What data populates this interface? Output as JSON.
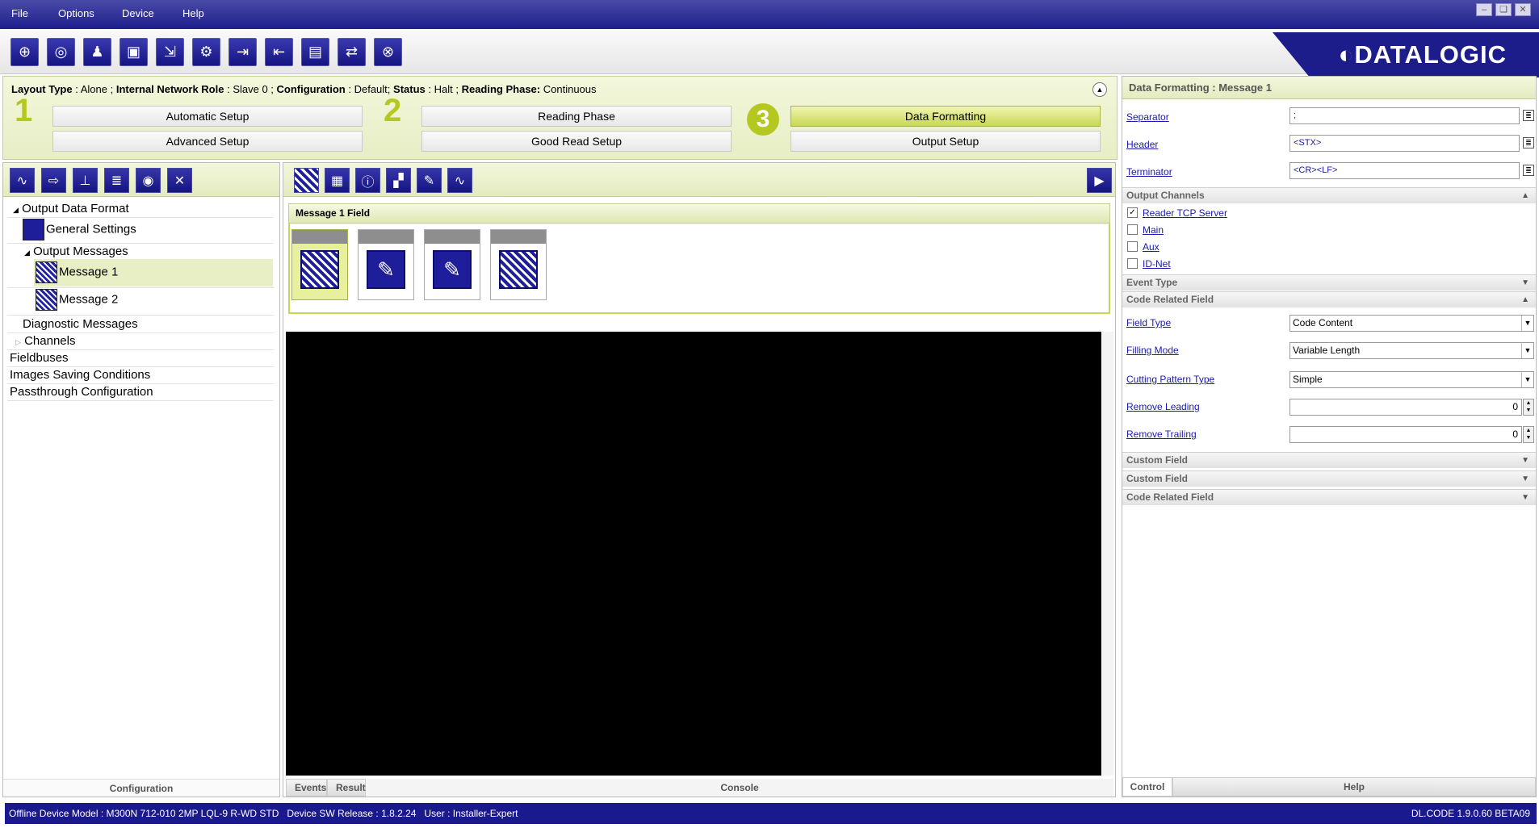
{
  "menu": {
    "file": "File",
    "options": "Options",
    "device": "Device",
    "help": "Help"
  },
  "window_controls": {
    "minimize": "–",
    "restore": "❏",
    "close": "✕"
  },
  "logo": "◐DATALOGIC",
  "toolbar_icons": [
    "crosshair-icon",
    "camera-search-icon",
    "user-icon",
    "layout-icon",
    "camera-arrow-icon",
    "camera-config-icon",
    "export-icon",
    "import-icon",
    "monitor-icon",
    "network-icon",
    "target-icon"
  ],
  "status_info": {
    "layout_type_label": "Layout Type",
    "layout_type_value": "Alone",
    "network_role_label": "Internal Network Role",
    "network_role_value": "Slave 0",
    "configuration_label": "Configuration",
    "configuration_value": "Default",
    "status_label": "Status",
    "status_value": "Halt",
    "reading_phase_label": "Reading Phase:",
    "reading_phase_value": "Continuous"
  },
  "wizard": {
    "step1": "1",
    "step2": "2",
    "step3": "3",
    "automatic_setup": "Automatic Setup",
    "advanced_setup": "Advanced Setup",
    "reading_phase": "Reading Phase",
    "good_read_setup": "Good Read Setup",
    "data_formatting": "Data Formatting",
    "output_setup": "Output Setup"
  },
  "tree": {
    "output_data_format": "Output Data Format",
    "general_settings": "General Settings",
    "output_messages": "Output Messages",
    "message1": "Message 1",
    "message2": "Message 2",
    "diagnostic_messages": "Diagnostic Messages",
    "channels": "Channels",
    "fieldbuses": "Fieldbuses",
    "images_saving": "Images Saving Conditions",
    "passthrough": "Passthrough Configuration"
  },
  "left_footer": "Configuration",
  "center": {
    "message_field_title": "Message 1 Field",
    "tabs": {
      "events": "Events",
      "result": "Result",
      "console": "Console"
    }
  },
  "right": {
    "title": "Data Formatting :  Message 1",
    "separator_label": "Separator",
    "separator_value": ";",
    "header_label": "Header",
    "header_value": "<STX>",
    "terminator_label": "Terminator",
    "terminator_value": "<CR><LF>",
    "output_channels": "Output Channels",
    "ch_reader_tcp": "Reader TCP Server",
    "ch_main": "Main",
    "ch_aux": "Aux",
    "ch_idnet": "ID-Net",
    "ch_reader_tcp_checked": true,
    "event_type": "Event Type",
    "code_related_field": "Code Related Field",
    "field_type_label": "Field Type",
    "field_type_value": "Code Content",
    "filling_mode_label": "Filling Mode",
    "filling_mode_value": "Variable Length",
    "cutting_pattern_label": "Cutting Pattern Type",
    "cutting_pattern_value": "Simple",
    "remove_leading_label": "Remove Leading",
    "remove_leading_value": "0",
    "remove_trailing_label": "Remove Trailing",
    "remove_trailing_value": "0",
    "custom_field_1": "Custom Field",
    "custom_field_2": "Custom Field",
    "code_related_field_2": "Code Related Field",
    "tab_control": "Control",
    "tab_help": "Help"
  },
  "statusbar": {
    "left": "Offline Device Model : M300N 712-010 2MP LQL-9 R-WD STD   Device SW Release : 1.8.2.24   User : Installer-Expert",
    "right": "DL.CODE 1.9.0.60 BETA09"
  },
  "colors": {
    "brand_blue": "#1c1c8a",
    "accent_green": "#b4c81f"
  }
}
